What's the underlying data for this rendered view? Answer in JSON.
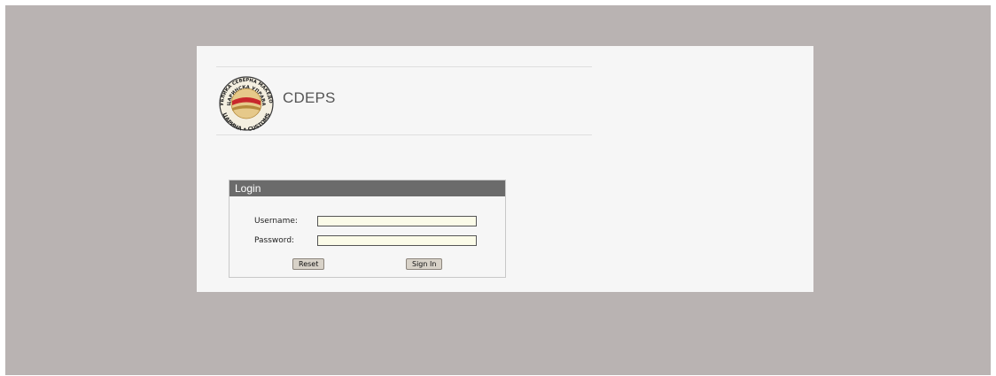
{
  "app": {
    "title": "CDEPS",
    "logo": {
      "text_top": "РЕПУБЛИКА СЕВЕРНА МАКЕДОНИЈА",
      "text_mid": "ЦАРИНСКА УПРАВА",
      "text_bottom": "ЦАРИНА • CUSTOMS"
    }
  },
  "login": {
    "header": "Login",
    "username_label": "Username:",
    "username_value": "",
    "password_label": "Password:",
    "password_value": "",
    "reset_label": "Reset",
    "signin_label": "Sign In"
  },
  "colors": {
    "backdrop": "#b9b3b2",
    "panel": "#f6f6f6",
    "login_header": "#6b6b6b",
    "input_bg": "#fbfbe8"
  }
}
